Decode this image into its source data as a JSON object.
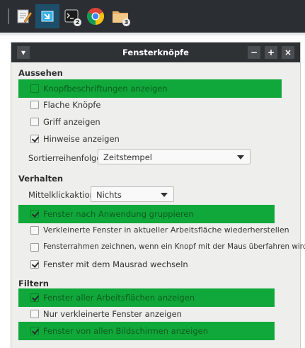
{
  "taskbar": {
    "items": [
      {
        "icon": "text-editor-icon",
        "active": false
      },
      {
        "icon": "window-manager-icon",
        "active": true
      },
      {
        "icon": "terminal-icon",
        "active": false,
        "badge": "2"
      },
      {
        "icon": "chrome-icon",
        "active": false
      },
      {
        "icon": "folder-icon",
        "active": false,
        "badge": "3"
      }
    ]
  },
  "dialog": {
    "title": "Fensterknöpfe",
    "controls": {
      "menu": "▾",
      "minimize": "−",
      "maximize": "+",
      "close": "×"
    },
    "sections": {
      "appearance": "Aussehen",
      "behavior": "Verhalten",
      "filter": "Filtern"
    },
    "appearance": {
      "show_labels": {
        "label": "Knopfbeschriftungen anzeigen",
        "checked": false,
        "highlighted": true
      },
      "flat_buttons": {
        "label": "Flache Knöpfe",
        "checked": false
      },
      "show_handle": {
        "label": "Griff anzeigen",
        "checked": false
      },
      "show_tooltips": {
        "label": "Hinweise anzeigen",
        "checked": true
      },
      "sort_order_label": "Sortierreihenfolge:",
      "sort_order_value": "Zeitstempel"
    },
    "behavior": {
      "middle_click_label": "Mittelklickaktion:",
      "middle_click_value": "Nichts",
      "group_by_app": {
        "label": "Fenster nach Anwendung gruppieren",
        "checked": true,
        "highlighted": true
      },
      "restore_minimized": {
        "label": "Verkleinerte Fenster in aktueller Arbeitsfläche wiederherstellen",
        "checked": false
      },
      "draw_frames": {
        "label": "Fensterrahmen zeichnen, wenn ein Knopf mit der Maus überfahren wird",
        "checked": false
      },
      "cycle_scroll": {
        "label": "Fenster mit dem Mausrad wechseln",
        "checked": true
      }
    },
    "filter": {
      "all_workspaces": {
        "label": "Fenster aller Arbeitsflächen anzeigen",
        "checked": true,
        "highlighted": true
      },
      "only_minimized": {
        "label": "Nur verkleinerte Fenster anzeigen",
        "checked": false
      },
      "all_monitors": {
        "label": "Fenster von allen Bildschirmen anzeigen",
        "checked": true,
        "highlighted": true
      }
    }
  },
  "colors": {
    "highlight": "#10a83a",
    "titlebar": "#2f3235",
    "taskbar": "#2b2f33"
  }
}
